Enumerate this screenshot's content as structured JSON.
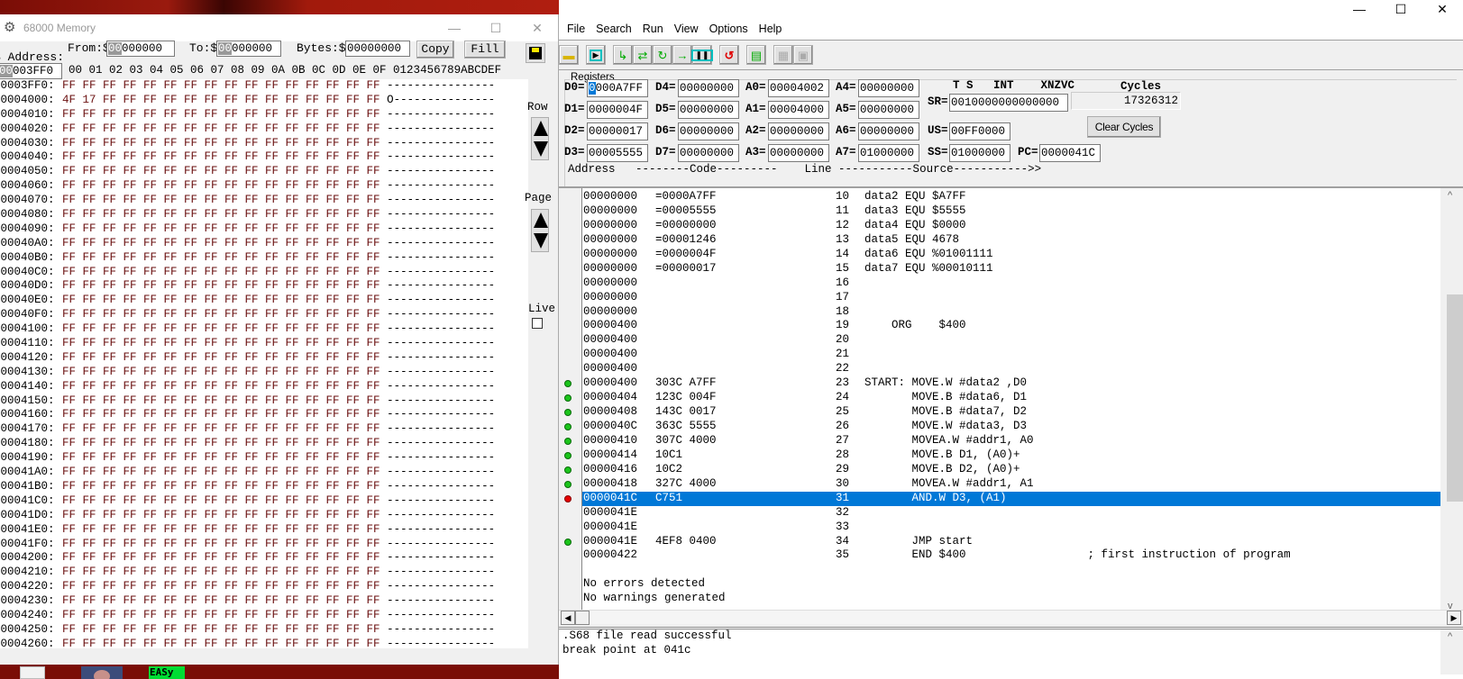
{
  "memory_window": {
    "title": "68000 Memory",
    "address_label": "$ Address:",
    "address_value_sel": "00",
    "address_value_rest": "003FF0",
    "from_label": "From:$",
    "from_sel": "00",
    "from_rest": "000000",
    "to_label": "To:$",
    "to_sel": "00",
    "to_rest": "000000",
    "bytes_label": "Bytes:$",
    "bytes_value": "00000000",
    "copy_label": "Copy",
    "fill_label": "Fill",
    "column_header": "00 01 02 03 04 05 06 07 08 09 0A 0B 0C 0D 0E 0F 0123456789ABCDEF",
    "row_label": "Row",
    "page_label": "Page",
    "live_label": "Live",
    "live_checked": false,
    "rows": [
      {
        "addr": "00003FF0:",
        "bytes": "FF FF FF FF FF FF FF FF FF FF FF FF FF FF FF FF",
        "ascii": "----------------"
      },
      {
        "addr": "00004000:",
        "bytes": "4F 17 FF FF FF FF FF FF FF FF FF FF FF FF FF FF",
        "ascii": "O---------------"
      },
      {
        "addr": "00004010:",
        "bytes": "FF FF FF FF FF FF FF FF FF FF FF FF FF FF FF FF",
        "ascii": "----------------"
      },
      {
        "addr": "00004020:",
        "bytes": "FF FF FF FF FF FF FF FF FF FF FF FF FF FF FF FF",
        "ascii": "----------------"
      },
      {
        "addr": "00004030:",
        "bytes": "FF FF FF FF FF FF FF FF FF FF FF FF FF FF FF FF",
        "ascii": "----------------"
      },
      {
        "addr": "00004040:",
        "bytes": "FF FF FF FF FF FF FF FF FF FF FF FF FF FF FF FF",
        "ascii": "----------------"
      },
      {
        "addr": "00004050:",
        "bytes": "FF FF FF FF FF FF FF FF FF FF FF FF FF FF FF FF",
        "ascii": "----------------"
      },
      {
        "addr": "00004060:",
        "bytes": "FF FF FF FF FF FF FF FF FF FF FF FF FF FF FF FF",
        "ascii": "----------------"
      },
      {
        "addr": "00004070:",
        "bytes": "FF FF FF FF FF FF FF FF FF FF FF FF FF FF FF FF",
        "ascii": "----------------"
      },
      {
        "addr": "00004080:",
        "bytes": "FF FF FF FF FF FF FF FF FF FF FF FF FF FF FF FF",
        "ascii": "----------------"
      },
      {
        "addr": "00004090:",
        "bytes": "FF FF FF FF FF FF FF FF FF FF FF FF FF FF FF FF",
        "ascii": "----------------"
      },
      {
        "addr": "000040A0:",
        "bytes": "FF FF FF FF FF FF FF FF FF FF FF FF FF FF FF FF",
        "ascii": "----------------"
      },
      {
        "addr": "000040B0:",
        "bytes": "FF FF FF FF FF FF FF FF FF FF FF FF FF FF FF FF",
        "ascii": "----------------"
      },
      {
        "addr": "000040C0:",
        "bytes": "FF FF FF FF FF FF FF FF FF FF FF FF FF FF FF FF",
        "ascii": "----------------"
      },
      {
        "addr": "000040D0:",
        "bytes": "FF FF FF FF FF FF FF FF FF FF FF FF FF FF FF FF",
        "ascii": "----------------"
      },
      {
        "addr": "000040E0:",
        "bytes": "FF FF FF FF FF FF FF FF FF FF FF FF FF FF FF FF",
        "ascii": "----------------"
      },
      {
        "addr": "000040F0:",
        "bytes": "FF FF FF FF FF FF FF FF FF FF FF FF FF FF FF FF",
        "ascii": "----------------"
      },
      {
        "addr": "00004100:",
        "bytes": "FF FF FF FF FF FF FF FF FF FF FF FF FF FF FF FF",
        "ascii": "----------------"
      },
      {
        "addr": "00004110:",
        "bytes": "FF FF FF FF FF FF FF FF FF FF FF FF FF FF FF FF",
        "ascii": "----------------"
      },
      {
        "addr": "00004120:",
        "bytes": "FF FF FF FF FF FF FF FF FF FF FF FF FF FF FF FF",
        "ascii": "----------------"
      },
      {
        "addr": "00004130:",
        "bytes": "FF FF FF FF FF FF FF FF FF FF FF FF FF FF FF FF",
        "ascii": "----------------"
      },
      {
        "addr": "00004140:",
        "bytes": "FF FF FF FF FF FF FF FF FF FF FF FF FF FF FF FF",
        "ascii": "----------------"
      },
      {
        "addr": "00004150:",
        "bytes": "FF FF FF FF FF FF FF FF FF FF FF FF FF FF FF FF",
        "ascii": "----------------"
      },
      {
        "addr": "00004160:",
        "bytes": "FF FF FF FF FF FF FF FF FF FF FF FF FF FF FF FF",
        "ascii": "----------------"
      },
      {
        "addr": "00004170:",
        "bytes": "FF FF FF FF FF FF FF FF FF FF FF FF FF FF FF FF",
        "ascii": "----------------"
      },
      {
        "addr": "00004180:",
        "bytes": "FF FF FF FF FF FF FF FF FF FF FF FF FF FF FF FF",
        "ascii": "----------------"
      },
      {
        "addr": "00004190:",
        "bytes": "FF FF FF FF FF FF FF FF FF FF FF FF FF FF FF FF",
        "ascii": "----------------"
      },
      {
        "addr": "000041A0:",
        "bytes": "FF FF FF FF FF FF FF FF FF FF FF FF FF FF FF FF",
        "ascii": "----------------"
      },
      {
        "addr": "000041B0:",
        "bytes": "FF FF FF FF FF FF FF FF FF FF FF FF FF FF FF FF",
        "ascii": "----------------"
      },
      {
        "addr": "000041C0:",
        "bytes": "FF FF FF FF FF FF FF FF FF FF FF FF FF FF FF FF",
        "ascii": "----------------"
      },
      {
        "addr": "000041D0:",
        "bytes": "FF FF FF FF FF FF FF FF FF FF FF FF FF FF FF FF",
        "ascii": "----------------"
      },
      {
        "addr": "000041E0:",
        "bytes": "FF FF FF FF FF FF FF FF FF FF FF FF FF FF FF FF",
        "ascii": "----------------"
      },
      {
        "addr": "000041F0:",
        "bytes": "FF FF FF FF FF FF FF FF FF FF FF FF FF FF FF FF",
        "ascii": "----------------"
      },
      {
        "addr": "00004200:",
        "bytes": "FF FF FF FF FF FF FF FF FF FF FF FF FF FF FF FF",
        "ascii": "----------------"
      },
      {
        "addr": "00004210:",
        "bytes": "FF FF FF FF FF FF FF FF FF FF FF FF FF FF FF FF",
        "ascii": "----------------"
      },
      {
        "addr": "00004220:",
        "bytes": "FF FF FF FF FF FF FF FF FF FF FF FF FF FF FF FF",
        "ascii": "----------------"
      },
      {
        "addr": "00004230:",
        "bytes": "FF FF FF FF FF FF FF FF FF FF FF FF FF FF FF FF",
        "ascii": "----------------"
      },
      {
        "addr": "00004240:",
        "bytes": "FF FF FF FF FF FF FF FF FF FF FF FF FF FF FF FF",
        "ascii": "----------------"
      },
      {
        "addr": "00004250:",
        "bytes": "FF FF FF FF FF FF FF FF FF FF FF FF FF FF FF FF",
        "ascii": "----------------"
      },
      {
        "addr": "00004260:",
        "bytes": "FF FF FF FF FF FF FF FF FF FF FF FF FF FF FF FF",
        "ascii": "----------------"
      }
    ]
  },
  "main_window": {
    "menu": [
      "File",
      "Search",
      "Run",
      "View",
      "Options",
      "Help"
    ],
    "toolbar_icons": [
      "open-folder-icon",
      "run-icon",
      "step-over-icon",
      "trace-into-icon",
      "step-return-icon",
      "run-to-cursor-icon",
      "pause-icon",
      "reset-icon",
      "open-file-icon",
      "log-disabled-icon",
      "log-disabled-2-icon"
    ],
    "registers_label": "Registers",
    "registers": {
      "D0": "0000A7FF",
      "D1": "0000004F",
      "D2": "00000017",
      "D3": "00005555",
      "D4": "00000000",
      "D5": "00000000",
      "D6": "00000000",
      "D7": "00000000",
      "A0": "00004002",
      "A1": "00004000",
      "A2": "00000000",
      "A3": "00000000",
      "A4": "00000000",
      "A5": "00000000",
      "A6": "00000000",
      "A7": "01000000",
      "SR": "0010000000000000",
      "US": "00FF0000",
      "SS": "01000000",
      "PC": "0000041C"
    },
    "d0_first_char": "0",
    "d0_rest": "000A7FF",
    "sr_flags_header": "T S   INT    XNZVC",
    "cycles_label": "Cycles",
    "cycles_value": "17326312",
    "clear_cycles_label": "Clear Cycles",
    "column_header": "Address   --------Code---------    Line -----------Source----------->>",
    "listing": [
      {
        "addr": "00000000",
        "code": "=0000A7FF",
        "line": "10",
        "src": "data2 EQU $A7FF",
        "bp": ""
      },
      {
        "addr": "00000000",
        "code": "=00005555",
        "line": "11",
        "src": "data3 EQU $5555",
        "bp": ""
      },
      {
        "addr": "00000000",
        "code": "=00000000",
        "line": "12",
        "src": "data4 EQU $0000",
        "bp": ""
      },
      {
        "addr": "00000000",
        "code": "=00001246",
        "line": "13",
        "src": "data5 EQU 4678",
        "bp": ""
      },
      {
        "addr": "00000000",
        "code": "=0000004F",
        "line": "14",
        "src": "data6 EQU %01001111",
        "bp": ""
      },
      {
        "addr": "00000000",
        "code": "=00000017",
        "line": "15",
        "src": "data7 EQU %00010111",
        "bp": ""
      },
      {
        "addr": "00000000",
        "code": "",
        "line": "16",
        "src": "",
        "bp": ""
      },
      {
        "addr": "00000000",
        "code": "",
        "line": "17",
        "src": "",
        "bp": ""
      },
      {
        "addr": "00000000",
        "code": "",
        "line": "18",
        "src": "",
        "bp": ""
      },
      {
        "addr": "00000400",
        "code": "",
        "line": "19",
        "src": "    ORG    $400",
        "bp": ""
      },
      {
        "addr": "00000400",
        "code": "",
        "line": "20",
        "src": "",
        "bp": ""
      },
      {
        "addr": "00000400",
        "code": "",
        "line": "21",
        "src": "",
        "bp": ""
      },
      {
        "addr": "00000400",
        "code": "",
        "line": "22",
        "src": "",
        "bp": ""
      },
      {
        "addr": "00000400",
        "code": "303C A7FF",
        "line": "23",
        "src": "START: MOVE.W #data2 ,D0",
        "bp": "green"
      },
      {
        "addr": "00000404",
        "code": "123C 004F",
        "line": "24",
        "src": "       MOVE.B #data6, D1",
        "bp": "green"
      },
      {
        "addr": "00000408",
        "code": "143C 0017",
        "line": "25",
        "src": "       MOVE.B #data7, D2",
        "bp": "green"
      },
      {
        "addr": "0000040C",
        "code": "363C 5555",
        "line": "26",
        "src": "       MOVE.W #data3, D3",
        "bp": "green"
      },
      {
        "addr": "00000410",
        "code": "307C 4000",
        "line": "27",
        "src": "       MOVEA.W #addr1, A0",
        "bp": "green"
      },
      {
        "addr": "00000414",
        "code": "10C1",
        "line": "28",
        "src": "       MOVE.B D1, (A0)+",
        "bp": "green"
      },
      {
        "addr": "00000416",
        "code": "10C2",
        "line": "29",
        "src": "       MOVE.B D2, (A0)+",
        "bp": "green"
      },
      {
        "addr": "00000418",
        "code": "327C 4000",
        "line": "30",
        "src": "       MOVEA.W #addr1, A1",
        "bp": "green"
      },
      {
        "addr": "0000041C",
        "code": "C751",
        "line": "31",
        "src": "       AND.W D3, (A1)",
        "bp": "red",
        "current": true
      },
      {
        "addr": "0000041E",
        "code": "",
        "line": "32",
        "src": "",
        "bp": ""
      },
      {
        "addr": "0000041E",
        "code": "",
        "line": "33",
        "src": "",
        "bp": ""
      },
      {
        "addr": "0000041E",
        "code": "4EF8 0400",
        "line": "34",
        "src": "       JMP start",
        "bp": "green"
      },
      {
        "addr": "00000422",
        "code": "",
        "line": "35",
        "src": "       END $400                  ; first instruction of program",
        "bp": ""
      },
      {
        "addr": "",
        "code": "",
        "line": "",
        "src": "",
        "bp": ""
      },
      {
        "addr": "No errors detected",
        "code": "",
        "line": "",
        "src": "",
        "bp": "",
        "msg": true
      },
      {
        "addr": "No warnings generated",
        "code": "",
        "line": "",
        "src": "",
        "bp": "",
        "msg": true
      }
    ],
    "messages": [
      ".S68 file read successful",
      "break point at 041c"
    ],
    "colors": {
      "highlight": "#0078d7",
      "breakpoint_active": "#1bc41b",
      "breakpoint_current": "#e50000"
    }
  }
}
